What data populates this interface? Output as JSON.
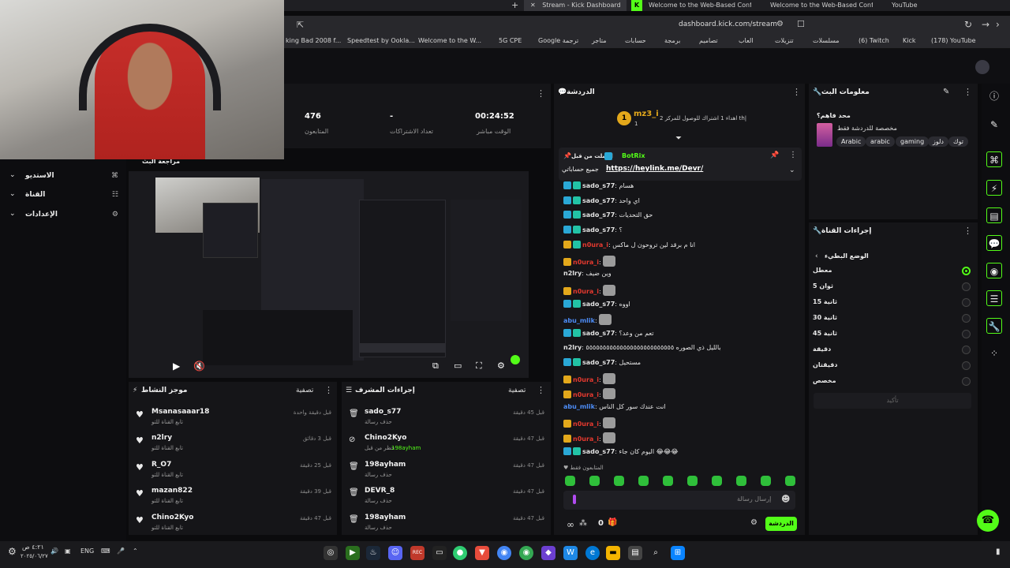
{
  "browser": {
    "tabs": [
      {
        "label": "Stream - Kick Dashboard",
        "active": true
      },
      {
        "label": "Welcome to the Web-Based Config::"
      },
      {
        "label": "Welcome to the Web-Based Config::"
      },
      {
        "label": "YouTube"
      }
    ],
    "url": "dashboard.kick.com/stream",
    "bookmarks": [
      "king Bad 2008 f...",
      "Speedtest by Ookla...",
      "Welcome to the W...",
      "5G CPE",
      "Google ترجمة",
      "متاجر",
      "حسابات",
      "برمجة",
      "تصاميم",
      "العاب",
      "تنزيلات",
      "مسلسلات",
      "(6) Twitch",
      "Kick",
      "(178) YouTube"
    ]
  },
  "stats": {
    "viewers_value": "476",
    "viewers_label": "المتابعون",
    "subs_value": "-",
    "subs_label": "تعداد الاشتراكات",
    "uptime_value": "00:24:52",
    "uptime_label": "الوقت مباشر"
  },
  "left_nav": {
    "items": [
      {
        "label": "الاستديو",
        "icon": "studio-icon"
      },
      {
        "label": "القناة",
        "icon": "channel-icon"
      },
      {
        "label": "الإعدادات",
        "icon": "gear-icon"
      }
    ],
    "preview_title": "مراجعة البث"
  },
  "activity_feed": {
    "title": "موجز النشاط",
    "filter": "تصفية",
    "rows": [
      {
        "name": "Msanasaaar18",
        "sub": "تابع القناة للتو",
        "time": "قبل دقيقة واحدة"
      },
      {
        "name": "n2lry",
        "sub": "تابع القناة للتو",
        "time": "قبل 3 دقائق"
      },
      {
        "name": "R_O7",
        "sub": "تابع القناة للتو",
        "time": "قبل 25 دقيقة"
      },
      {
        "name": "mazan822",
        "sub": "تابع القناة للتو",
        "time": "قبل 39 دقيقة"
      },
      {
        "name": "Chino2Kyo",
        "sub": "تابع القناة للتو",
        "time": "قبل 47 دقيقة"
      }
    ]
  },
  "mod_actions": {
    "title": "إجراءات المشرف",
    "filter": "تصفية",
    "rows": [
      {
        "name": "sado_s77",
        "sub": "حذف رسالة",
        "sub_green": "",
        "time": "قبل 45 دقيقة",
        "icon": "trash-icon"
      },
      {
        "name": "Chino2Kyo",
        "sub": "حظر من قبل",
        "sub_green": "198ayham",
        "time": "قبل 47 دقيقة",
        "icon": "ban-icon"
      },
      {
        "name": "198ayham",
        "sub": "حذف رسالة",
        "sub_green": "",
        "time": "قبل 47 دقيقة",
        "icon": "trash-icon"
      },
      {
        "name": "DEVR_8",
        "sub": "حذف رسالة",
        "sub_green": "",
        "time": "قبل 47 دقيقة",
        "icon": "trash-icon"
      },
      {
        "name": "198ayham",
        "sub": "حذف رسالة",
        "sub_green": "",
        "time": "قبل 47 دقيقة",
        "icon": "trash-icon"
      }
    ]
  },
  "chat": {
    "title": "الدردشة",
    "top_gifter": {
      "name": "mz3_i",
      "count": "1",
      "rank": "1",
      "note": "اهداء 1 اشتراك للوصول للمركز 2 th|"
    },
    "pinned": {
      "by": "ارسلت من قبل",
      "author": "BotRix",
      "text": "جميع حساباتي",
      "link": "https://heylink.me/Devr/"
    },
    "messages": [
      {
        "user": "sado_s77",
        "color": "#e2e2e2",
        "badges": [
          "blue",
          "teal"
        ],
        "text": "هسام"
      },
      {
        "user": "sado_s77",
        "color": "#e2e2e2",
        "badges": [
          "blue",
          "teal"
        ],
        "text": "اي واحد"
      },
      {
        "user": "sado_s77",
        "color": "#e2e2e2",
        "badges": [
          "blue",
          "teal"
        ],
        "text": "حق التحديات"
      },
      {
        "user": "sado_s77",
        "color": "#e2e2e2",
        "badges": [
          "blue",
          "teal"
        ],
        "text": "؟"
      },
      {
        "user": "n0ura_i",
        "color": "#e5392f",
        "badges": [
          "gold",
          "teal"
        ],
        "text": "انا م برقد لين تروحون ل ماكس"
      },
      {
        "user": "n0ura_i",
        "color": "#e5392f",
        "badges": [
          "gold"
        ],
        "text": "",
        "emote": true
      },
      {
        "user": "n2lry",
        "color": "#e2e2e2",
        "badges": [],
        "text": "وين ضيف"
      },
      {
        "user": "n0ura_i",
        "color": "#e5392f",
        "badges": [
          "gold"
        ],
        "text": "",
        "emote": true
      },
      {
        "user": "sado_s77",
        "color": "#e2e2e2",
        "badges": [
          "blue",
          "teal"
        ],
        "text": "اووه"
      },
      {
        "user": "abu_mlik",
        "color": "#4d8cf5",
        "badges": [],
        "text": "",
        "emote": true
      },
      {
        "user": "sado_s77",
        "color": "#e2e2e2",
        "badges": [
          "blue",
          "teal"
        ],
        "text": "تعم من وعد؟"
      },
      {
        "user": "n2lry",
        "color": "#e2e2e2",
        "badges": [],
        "text": "بالليل ذي الصوره ٥٥٥٥٥٥٥٥٥٥٥٥٥٥٥٥٥٥٥٥٥٥٥٥٥٥"
      },
      {
        "user": "sado_s77",
        "color": "#e2e2e2",
        "badges": [
          "blue",
          "teal"
        ],
        "text": "مستحيل"
      },
      {
        "user": "n0ura_i",
        "color": "#e5392f",
        "badges": [
          "gold"
        ],
        "text": "",
        "emote": true
      },
      {
        "user": "n0ura_i",
        "color": "#e5392f",
        "badges": [
          "gold"
        ],
        "text": "",
        "emote": true
      },
      {
        "user": "abu_mlik",
        "color": "#4d8cf5",
        "badges": [],
        "text": "انت عندك سور كل الناس"
      },
      {
        "user": "n0ura_i",
        "color": "#e5392f",
        "badges": [
          "gold"
        ],
        "text": "",
        "emote": true
      },
      {
        "user": "n0ura_i",
        "color": "#e5392f",
        "badges": [
          "gold"
        ],
        "text": "",
        "emote": true
      },
      {
        "user": "sado_s77",
        "color": "#e2e2e2",
        "badges": [
          "blue",
          "teal"
        ],
        "text": "اليوم كان جاء 😂😂😂"
      }
    ],
    "followers_only": "المتابعون فقط",
    "input_placeholder": "إرسال رسالة",
    "viewers_count": "0",
    "send_label": "الدردشة"
  },
  "stream_info": {
    "title": "معلومات البث",
    "stream_title": "محد فاهم؟",
    "category": "مخصصة للدردشة فقط",
    "tags": [
      "توك",
      "دلوز",
      "gaming",
      "arabic",
      "Arabic"
    ]
  },
  "channel_actions": {
    "title": "إجراءات القناة",
    "slow_mode_label": "الوضع البطيء",
    "options": [
      {
        "label": "معطل",
        "selected": true
      },
      {
        "label": "5 ثوان",
        "selected": false
      },
      {
        "label": "15 ثانية",
        "selected": false
      },
      {
        "label": "30 ثانية",
        "selected": false
      },
      {
        "label": "45 ثانية",
        "selected": false
      },
      {
        "label": "دقيقة",
        "selected": false
      },
      {
        "label": "دقيقتان",
        "selected": false
      },
      {
        "label": "مخصص",
        "selected": false
      }
    ],
    "confirm_label": "تأكيد"
  },
  "taskbar": {
    "time": "٤:٢١ ص",
    "date": "٢٠٢٥/٠٦/٢٧",
    "lang": "ENG"
  },
  "colors": {
    "accent": "#53fc18",
    "panel": "#151518",
    "background": "#0b0b0d"
  }
}
